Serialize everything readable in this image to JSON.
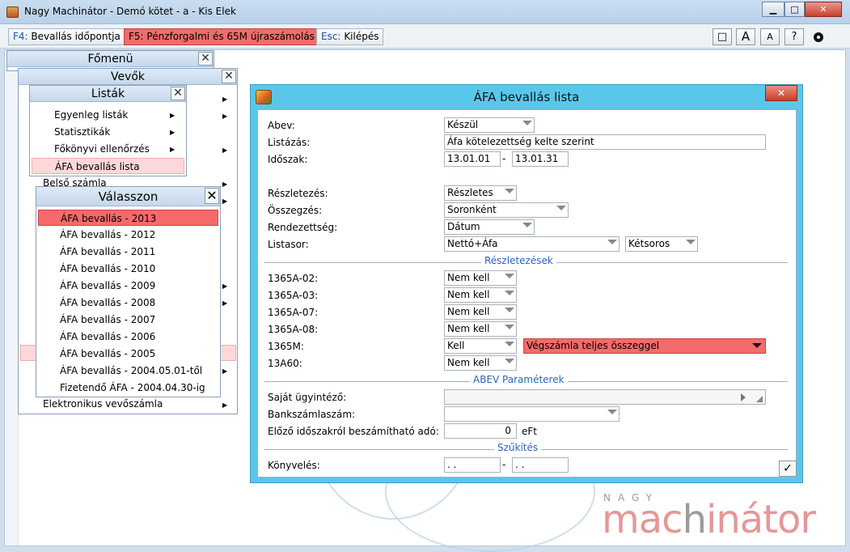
{
  "window": {
    "title": "Nagy Machinátor - Demó kötet - a - Kis Elek",
    "min": "▁",
    "max": "□",
    "close": "✕"
  },
  "toolbar": {
    "f4_key": "F4:",
    "f4_label": "Bevallás időpontja",
    "f5_key": "F5:",
    "f5_label": "Pénzforgalmi és 65M újraszámolás",
    "esc_key": "Esc:",
    "esc_label": "Kilépés",
    "btn_window": "□",
    "btn_font_big": "A",
    "btn_font_small": "A",
    "btn_help": "?"
  },
  "menus": {
    "fomenu": {
      "title": "Főmenü",
      "close": "✕"
    },
    "vevok": {
      "title": "Vevők",
      "close": "✕",
      "items": [
        "Belső számla",
        "Elektronikus vevőszámla"
      ]
    },
    "listak": {
      "title": "Listák",
      "close": "✕",
      "items": [
        "Egyenleg listák",
        "Statisztikák",
        "Főkönyvi ellenőrzés",
        "ÁFA bevallás lista"
      ]
    },
    "valasszon": {
      "title": "Válasszon",
      "close": "✕",
      "items": [
        "ÁFA bevallás - 2013",
        "ÁFA bevallás - 2012",
        "ÁFA bevallás - 2011",
        "ÁFA bevallás - 2010",
        "ÁFA bevallás - 2009",
        "ÁFA bevallás - 2008",
        "ÁFA bevallás - 2007",
        "ÁFA bevallás - 2006",
        "ÁFA bevallás - 2005",
        "ÁFA bevallás - 2004.05.01-től",
        "Fizetendő ÁFA - 2004.04.30-ig"
      ]
    }
  },
  "dialog": {
    "title": "ÁFA bevallás lista",
    "close": "✕",
    "abev_label": "Abev:",
    "abev_value": "Készül",
    "listazas_label": "Listázás:",
    "listazas_value": "Áfa kötelezettség kelte szerint",
    "idoszak_label": "Időszak:",
    "idoszak_from": "13.01.01",
    "idoszak_dash": "-",
    "idoszak_to": "13.01.31",
    "reszletezes_label": "Részletezés:",
    "reszletezes_value": "Részletes",
    "osszegzes_label": "Összegzés:",
    "osszegzes_value": "Soronként",
    "rendezettseg_label": "Rendezettség:",
    "rendezettseg_value": "Dátum",
    "listasor_label": "Listasor:",
    "listasor_value": "Nettó+Áfa",
    "listasor_value2": "Kétsoros",
    "section_reszletezesek": "Részletezések",
    "rows": [
      {
        "label": "1365A-02:",
        "value": "Nem kell"
      },
      {
        "label": "1365A-03:",
        "value": "Nem kell"
      },
      {
        "label": "1365A-07:",
        "value": "Nem kell"
      },
      {
        "label": "1365A-08:",
        "value": "Nem kell"
      },
      {
        "label": "1365M:",
        "value": "Kell"
      },
      {
        "label": "13A60:",
        "value": "Nem kell"
      }
    ],
    "vegszamla_value": "Végszámla teljes összeggel",
    "section_abev": "ABEV Paraméterek",
    "ugyintezo_label": "Saját ügyintéző:",
    "ugyintezo_value": "",
    "bankszamla_label": "Bankszámlaszám:",
    "bankszamla_value": "",
    "elozo_label": "Előző időszakról beszámítható adó:",
    "elozo_value": "0",
    "elozo_unit": "eFt",
    "section_szukites": "Szűkítés",
    "konyveles_label": "Könyvelés:",
    "konyveles_from": " .  .",
    "konyveles_dash": "-",
    "konyveles_to": " .  .",
    "ok": "✓"
  },
  "logo": {
    "small": "NAGY",
    "big_a": "mac",
    "big_b": "h",
    "big_c": "inátor"
  }
}
